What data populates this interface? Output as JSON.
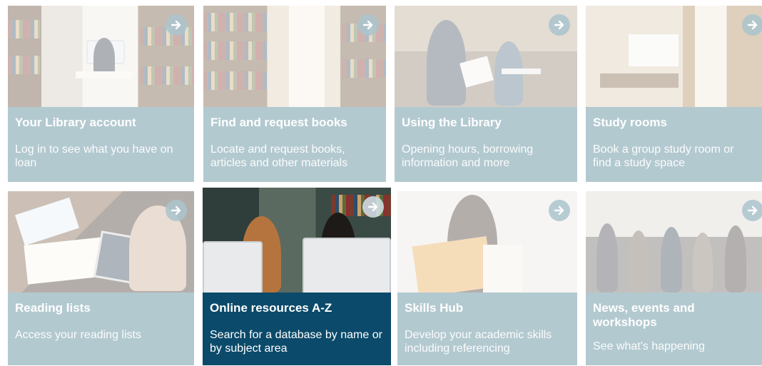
{
  "tiles": [
    {
      "title": "Your Library account",
      "description": "Log in to see what you have on loan",
      "image": "library-desk-photo",
      "icon": "arrow-right-icon",
      "active": false
    },
    {
      "title": "Find and request books",
      "description": "Locate and request books, articles and other materials",
      "image": "bookshelves-photo",
      "icon": "arrow-right-icon",
      "active": false
    },
    {
      "title": "Using the Library",
      "description": "Opening hours, borrowing information and more",
      "image": "students-reading-photo",
      "icon": "arrow-right-icon",
      "active": false
    },
    {
      "title": "Study rooms",
      "description": "Book a group study room or find a study space",
      "image": "study-room-photo",
      "icon": "arrow-right-icon",
      "active": false
    },
    {
      "title": "Reading lists",
      "description": "Access your reading lists",
      "image": "books-tablet-photo",
      "icon": "arrow-right-icon",
      "active": false
    },
    {
      "title": "Online resources A-Z",
      "description": "Search for a database by name or by subject area",
      "image": "students-computers-photo",
      "icon": "arrow-right-icon",
      "active": true
    },
    {
      "title": "Skills Hub",
      "description": "Develop your academic skills including referencing",
      "image": "student-reading-book-photo",
      "icon": "arrow-right-icon",
      "active": false
    },
    {
      "title": "News, events and workshops",
      "description": "See what's happening",
      "image": "event-crowd-photo",
      "icon": "arrow-right-icon",
      "active": false
    }
  ],
  "colors": {
    "caption_inactive": "#b3c9d0",
    "caption_active": "#0b4a6a",
    "text": "#ffffff"
  }
}
